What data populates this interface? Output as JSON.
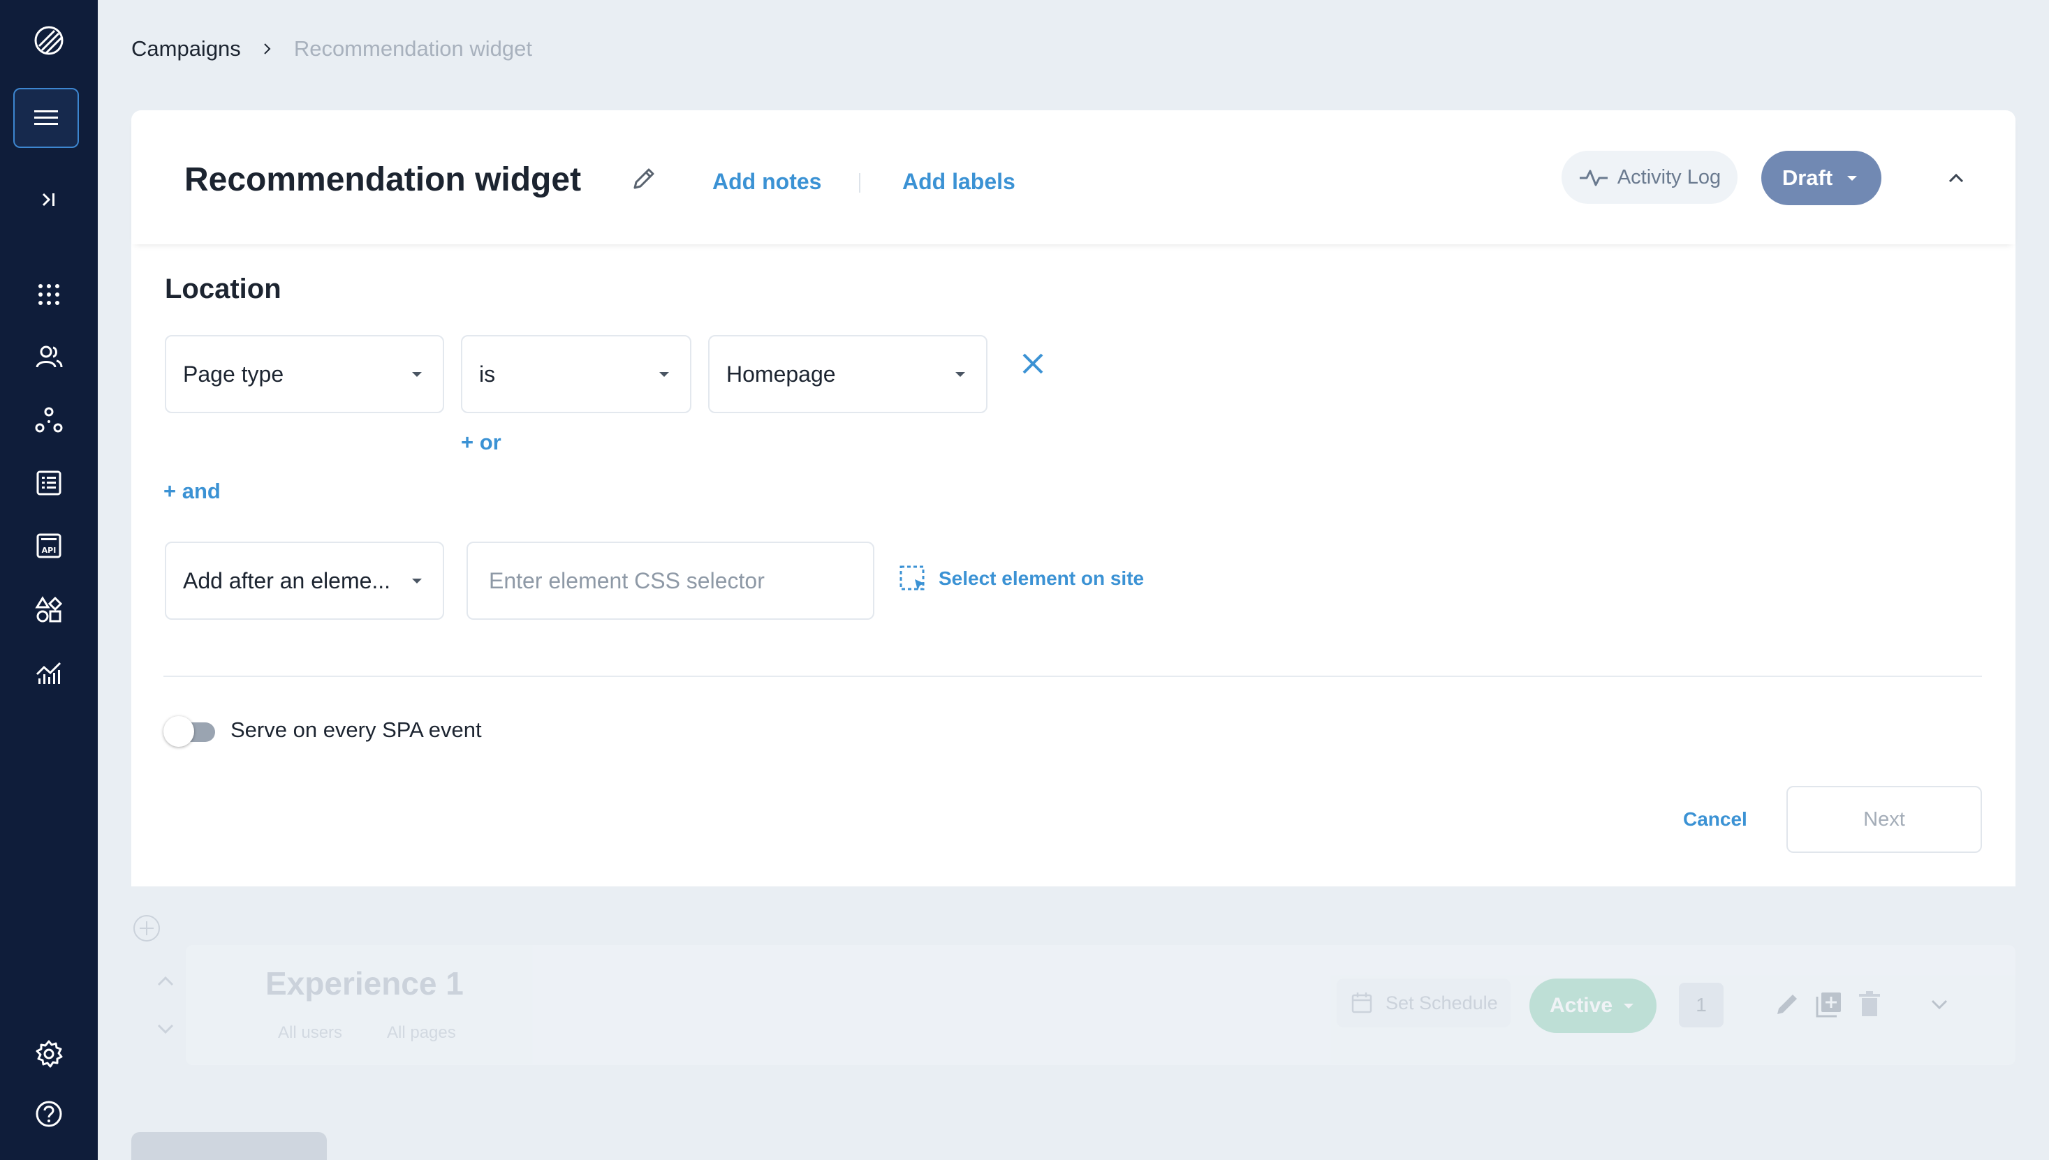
{
  "breadcrumb": {
    "parent": "Campaigns",
    "current": "Recommendation widget"
  },
  "header": {
    "title": "Recommendation widget",
    "add_notes": "Add notes",
    "add_labels": "Add labels",
    "activity_log": "Activity Log",
    "status": "Draft"
  },
  "location": {
    "title": "Location",
    "condition": {
      "field": "Page type",
      "operator": "is",
      "value": "Homepage"
    },
    "or_link": "+ or",
    "and_link": "+ and",
    "placement": {
      "mode": "Add after an eleme...",
      "selector_placeholder": "Enter element CSS selector",
      "selector_value": "",
      "select_on_site": "Select element on site"
    },
    "spa_toggle": {
      "label": "Serve on every SPA event",
      "on": false
    },
    "cancel": "Cancel",
    "next": "Next"
  },
  "experience": {
    "title": "Experience 1",
    "users": "All users",
    "pages": "All pages",
    "schedule": "Set Schedule",
    "status": "Active",
    "count": "1"
  },
  "colors": {
    "sidebar": "#0f1d3a",
    "accent": "#3b92d4",
    "draft": "#7189b3",
    "active": "#67c19a"
  },
  "icons": [
    "logo-icon",
    "menu-icon",
    "expand-icon",
    "apps-icon",
    "users-icon",
    "journeys-icon",
    "list-icon",
    "api-icon",
    "widgets-icon",
    "analytics-icon",
    "settings-icon",
    "help-icon",
    "pencil-icon",
    "pulse-icon",
    "chevron-down-icon",
    "chevron-up-icon",
    "close-icon",
    "select-element-icon",
    "calendar-icon",
    "duplicate-icon",
    "trash-icon"
  ]
}
